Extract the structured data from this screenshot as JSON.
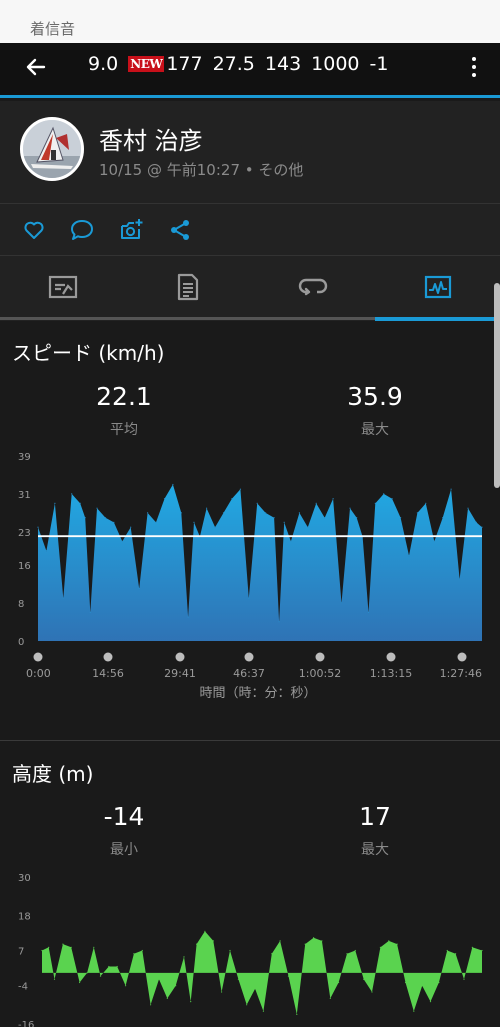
{
  "status_bar": {
    "text": "着信音"
  },
  "app_bar": {
    "values": [
      "9.0",
      "177",
      "27.5",
      "143",
      "1000",
      "-1"
    ],
    "new_badge": "NEW"
  },
  "profile": {
    "name": "香村 治彦",
    "meta": "10/15 @ 午前10:27 • その他"
  },
  "actions": [
    "heart-icon",
    "comment-icon",
    "add-photo-icon",
    "share-icon"
  ],
  "tabs": [
    {
      "name": "summary",
      "icon": "map-chart-icon",
      "active": false
    },
    {
      "name": "details",
      "icon": "document-icon",
      "active": false
    },
    {
      "name": "laps",
      "icon": "laps-icon",
      "active": false
    },
    {
      "name": "charts",
      "icon": "chart-icon",
      "active": true
    }
  ],
  "colors": {
    "accent": "#1a9ad6",
    "speed_fill": "#1e9bd7",
    "elevation_fill": "#5ad34f",
    "background": "#1a1a1a"
  },
  "speed": {
    "title": "スピード (km/h)",
    "avg_value": "22.1",
    "avg_label": "平均",
    "max_value": "35.9",
    "max_label": "最大",
    "x_axis_title": "時間（時：分：秒）"
  },
  "elevation": {
    "title": "高度 (m)",
    "min_value": "-14",
    "min_label": "最小",
    "max_value": "17",
    "max_label": "最大"
  },
  "chart_data": [
    {
      "type": "area",
      "title": "スピード (km/h)",
      "ylim": [
        0,
        39
      ],
      "y_ticks": [
        0,
        8,
        16,
        23,
        31,
        39
      ],
      "x_ticks": [
        "0:00",
        "14:56",
        "29:41",
        "46:37",
        "1:00:52",
        "1:13:15",
        "1:27:46"
      ],
      "x_range_seconds": [
        0,
        5266
      ],
      "reference_line": 22.1,
      "x": [
        0,
        100,
        200,
        300,
        400,
        500,
        560,
        620,
        700,
        800,
        900,
        1000,
        1100,
        1200,
        1300,
        1400,
        1500,
        1600,
        1700,
        1780,
        1850,
        1920,
        2000,
        2100,
        2200,
        2300,
        2400,
        2500,
        2600,
        2700,
        2800,
        2860,
        2920,
        3000,
        3100,
        3200,
        3300,
        3400,
        3500,
        3600,
        3700,
        3780,
        3850,
        3920,
        4000,
        4100,
        4200,
        4300,
        4400,
        4500,
        4600,
        4700,
        4800,
        4900,
        5000,
        5100,
        5200,
        5266
      ],
      "y": [
        24,
        19,
        29,
        9,
        31,
        29,
        26,
        6,
        28,
        26,
        25,
        21,
        24,
        11,
        27,
        25,
        30,
        33,
        27,
        5,
        25,
        22,
        28,
        24,
        27,
        30,
        32,
        9,
        29,
        27,
        26,
        4,
        25,
        21,
        27,
        24,
        29,
        26,
        30,
        8,
        28,
        26,
        22,
        6,
        29,
        31,
        30,
        26,
        18,
        27,
        29,
        21,
        26,
        32,
        13,
        28,
        25,
        24
      ]
    },
    {
      "type": "area",
      "title": "高度 (m)",
      "ylim": [
        -16,
        30
      ],
      "y_ticks": [
        -16,
        -4,
        7,
        18,
        30
      ],
      "x_range_seconds": [
        0,
        5266
      ],
      "x": [
        0,
        80,
        150,
        250,
        350,
        450,
        540,
        620,
        700,
        800,
        900,
        1000,
        1100,
        1200,
        1300,
        1400,
        1500,
        1600,
        1700,
        1780,
        1850,
        1950,
        2050,
        2150,
        2250,
        2350,
        2450,
        2550,
        2650,
        2750,
        2850,
        2950,
        3050,
        3150,
        3250,
        3350,
        3450,
        3550,
        3650,
        3750,
        3850,
        3950,
        4050,
        4150,
        4250,
        4350,
        4450,
        4550,
        4650,
        4750,
        4850,
        4950,
        5050,
        5150,
        5266
      ],
      "y": [
        7,
        8,
        -2,
        9,
        8,
        -3,
        0,
        8,
        -1,
        2,
        2,
        -4,
        6,
        7,
        -10,
        -2,
        -8,
        -4,
        5,
        -9,
        9,
        13,
        10,
        -6,
        7,
        -2,
        -10,
        -5,
        -12,
        6,
        10,
        -1,
        -13,
        9,
        11,
        10,
        -8,
        -3,
        6,
        7,
        -2,
        -6,
        8,
        10,
        9,
        -3,
        -12,
        -4,
        -9,
        -3,
        7,
        6,
        -2,
        8,
        7
      ]
    }
  ]
}
